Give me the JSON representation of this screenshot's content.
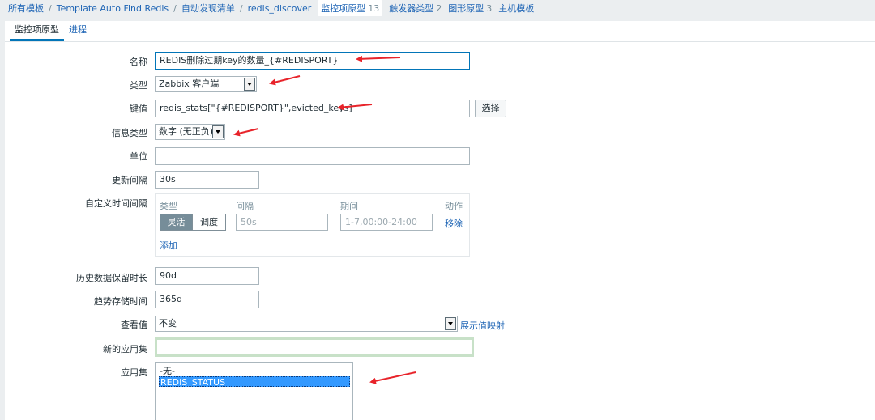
{
  "breadcrumb": {
    "items": [
      {
        "label": "所有模板"
      },
      {
        "label": "Template Auto Find Redis"
      },
      {
        "label": "自动发现清单"
      },
      {
        "label": "redis_discover"
      }
    ],
    "tabs": [
      {
        "label": "监控项原型",
        "count": "13"
      },
      {
        "label": "触发器类型",
        "count": "2"
      },
      {
        "label": "图形原型",
        "count": "3"
      },
      {
        "label": "主机模板",
        "count": ""
      }
    ]
  },
  "tabs": {
    "items": [
      {
        "label": "监控项原型"
      },
      {
        "label": "进程"
      }
    ]
  },
  "form": {
    "name": {
      "label": "名称",
      "value": "REDIS删除过期key的数量_{#REDISPORT}"
    },
    "type": {
      "label": "类型",
      "value": "Zabbix 客户端"
    },
    "key": {
      "label": "键值",
      "value": "redis_stats[\"{#REDISPORT}\",evicted_keys]",
      "select_button": "选择"
    },
    "info_type": {
      "label": "信息类型",
      "value": "数字 (无正负)"
    },
    "units": {
      "label": "单位",
      "value": ""
    },
    "update_interval": {
      "label": "更新间隔",
      "value": "30s"
    },
    "custom_intervals": {
      "label": "自定义时间间隔",
      "headers": {
        "type": "类型",
        "interval": "间隔",
        "period": "期间",
        "action": "动作"
      },
      "toggle_flexible": "灵活",
      "toggle_scheduling": "调度",
      "interval_placeholder": "50s",
      "period_placeholder": "1-7,00:00-24:00",
      "remove_link": "移除",
      "add_link": "添加"
    },
    "history": {
      "label": "历史数据保留时长",
      "value": "90d"
    },
    "trends": {
      "label": "趋势存储时间",
      "value": "365d"
    },
    "show_value": {
      "label": "查看值",
      "value": "不变",
      "mapping_link": "展示值映射"
    },
    "new_application": {
      "label": "新的应用集",
      "value": ""
    },
    "applications": {
      "label": "应用集",
      "options": [
        {
          "label": "-无-",
          "selected": false
        },
        {
          "label": "REDIS_STATUS",
          "selected": true
        }
      ]
    }
  },
  "colors": {
    "link": "#1f65b5",
    "annotation_arrow": "#e8232a",
    "selected_option": "#3399ff"
  }
}
